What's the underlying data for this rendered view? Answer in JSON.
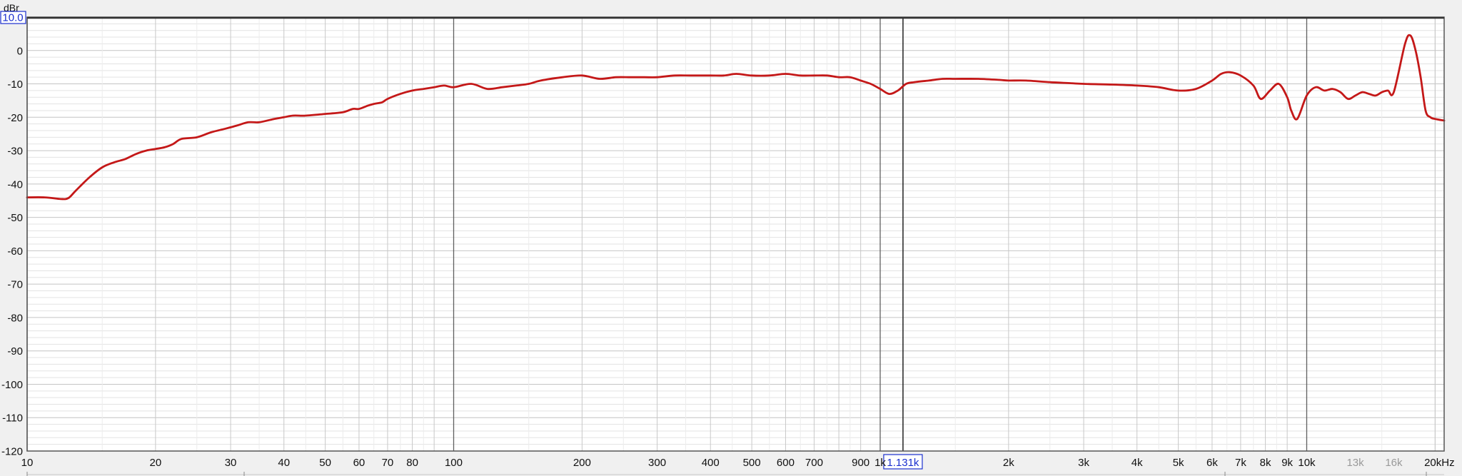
{
  "chart_data": {
    "type": "line",
    "title": "",
    "xlabel": "",
    "ylabel": "dBr",
    "x_scale": "log",
    "xlim": [
      10,
      21000
    ],
    "ylim": [
      -120,
      10
    ],
    "grid": true,
    "y_ticks": [
      {
        "value": 10,
        "label": "10.0",
        "boxed": true
      },
      {
        "value": 0,
        "label": "0"
      },
      {
        "value": -10,
        "label": "-10"
      },
      {
        "value": -20,
        "label": "-20"
      },
      {
        "value": -30,
        "label": "-30"
      },
      {
        "value": -40,
        "label": "-40"
      },
      {
        "value": -50,
        "label": "-50"
      },
      {
        "value": -60,
        "label": "-60"
      },
      {
        "value": -70,
        "label": "-70"
      },
      {
        "value": -80,
        "label": "-80"
      },
      {
        "value": -90,
        "label": "-90"
      },
      {
        "value": -100,
        "label": "-100"
      },
      {
        "value": -110,
        "label": "-110"
      },
      {
        "value": -120,
        "label": "-120"
      }
    ],
    "x_ticks": [
      {
        "value": 10,
        "label": "10"
      },
      {
        "value": 20,
        "label": "20"
      },
      {
        "value": 30,
        "label": "30"
      },
      {
        "value": 40,
        "label": "40"
      },
      {
        "value": 50,
        "label": "50"
      },
      {
        "value": 60,
        "label": "60"
      },
      {
        "value": 70,
        "label": "70"
      },
      {
        "value": 80,
        "label": "80"
      },
      {
        "value": 100,
        "label": "100"
      },
      {
        "value": 200,
        "label": "200"
      },
      {
        "value": 300,
        "label": "300"
      },
      {
        "value": 400,
        "label": "400"
      },
      {
        "value": 500,
        "label": "500"
      },
      {
        "value": 600,
        "label": "600"
      },
      {
        "value": 700,
        "label": "700"
      },
      {
        "value": 900,
        "label": "900"
      },
      {
        "value": 1000,
        "label": "1k"
      },
      {
        "value": 2000,
        "label": "2k"
      },
      {
        "value": 3000,
        "label": "3k"
      },
      {
        "value": 4000,
        "label": "4k"
      },
      {
        "value": 5000,
        "label": "5k"
      },
      {
        "value": 6000,
        "label": "6k"
      },
      {
        "value": 7000,
        "label": "7k"
      },
      {
        "value": 8000,
        "label": "8k"
      },
      {
        "value": 9000,
        "label": "9k"
      },
      {
        "value": 10000,
        "label": "10k"
      },
      {
        "value": 13000,
        "label": "13k",
        "faint": true
      },
      {
        "value": 16000,
        "label": "16k",
        "faint": true
      },
      {
        "value": 20000,
        "label": "20kHz"
      }
    ],
    "cursor": {
      "value": 1131,
      "label": "1.131k"
    },
    "line_color": "#c41818",
    "series": [
      {
        "x": [
          10,
          11,
          12,
          12.5,
          13,
          14,
          15,
          16,
          17,
          18,
          19,
          20,
          21,
          22,
          23,
          25,
          27,
          29,
          31,
          33,
          35,
          38,
          40,
          42,
          45,
          50,
          55,
          58,
          60,
          63,
          65,
          68,
          70,
          75,
          80,
          85,
          90,
          95,
          100,
          110,
          120,
          130,
          140,
          150,
          160,
          180,
          200,
          220,
          240,
          260,
          280,
          300,
          330,
          360,
          400,
          430,
          460,
          500,
          550,
          600,
          650,
          700,
          750,
          800,
          850,
          900,
          950,
          1000,
          1050,
          1100,
          1150,
          1200,
          1300,
          1400,
          1500,
          1700,
          1900,
          2000,
          2200,
          2500,
          2800,
          3000,
          3500,
          4000,
          4500,
          5000,
          5500,
          6000,
          6300,
          6600,
          7000,
          7500,
          7800,
          8200,
          8600,
          9000,
          9200,
          9500,
          10000,
          10500,
          11000,
          11500,
          12000,
          12500,
          13000,
          13500,
          14000,
          14500,
          15000,
          15500,
          16000,
          17000,
          17500,
          18000,
          18500,
          19000,
          19500,
          20000,
          21000
        ],
        "y": [
          -44,
          -44,
          -44.5,
          -44.2,
          -42,
          -38,
          -35,
          -33.5,
          -32.5,
          -31,
          -30,
          -29.5,
          -29,
          -28,
          -26.5,
          -26,
          -24.5,
          -23.5,
          -22.5,
          -21.5,
          -21.5,
          -20.5,
          -20,
          -19.5,
          -19.5,
          -19,
          -18.5,
          -17.5,
          -17.5,
          -16.5,
          -16,
          -15.5,
          -14.5,
          -13,
          -12,
          -11.5,
          -11,
          -10.5,
          -11,
          -10,
          -11.5,
          -11,
          -10.5,
          -10,
          -9,
          -8,
          -7.5,
          -8.5,
          -8,
          -8,
          -8,
          -8,
          -7.5,
          -7.5,
          -7.5,
          -7.5,
          -7,
          -7.5,
          -7.5,
          -7,
          -7.5,
          -7.5,
          -7.5,
          -8,
          -8,
          -9,
          -10,
          -11.5,
          -13,
          -12,
          -10,
          -9.5,
          -9,
          -8.5,
          -8.5,
          -8.5,
          -8.8,
          -9,
          -9,
          -9.5,
          -9.8,
          -10,
          -10.2,
          -10.5,
          -11,
          -12,
          -11.5,
          -9,
          -7,
          -6.5,
          -7.5,
          -10.5,
          -14.5,
          -12,
          -10,
          -14,
          -18,
          -20.5,
          -13.5,
          -11,
          -12,
          -11.5,
          -12.5,
          -14.5,
          -13.5,
          -12.5,
          -13,
          -13.5,
          -12.5,
          -12,
          -12.5,
          2,
          4.5,
          0,
          -8,
          -18,
          -20,
          -20.5,
          -21
        ]
      }
    ]
  }
}
